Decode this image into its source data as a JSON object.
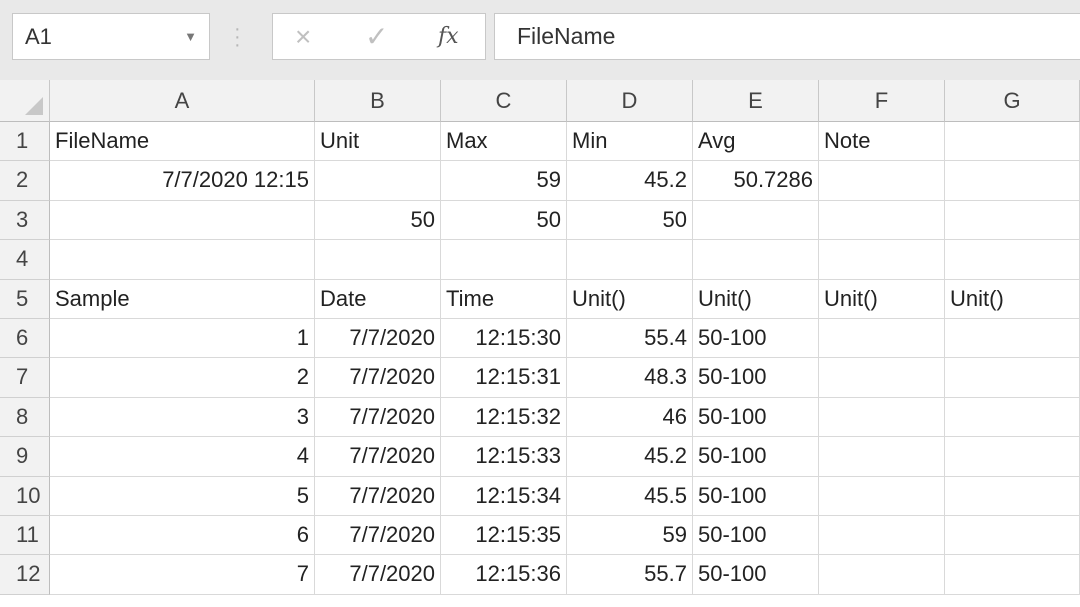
{
  "formula_bar": {
    "name_box": "A1",
    "formula": "FileName",
    "fx_label": "fx",
    "cancel_icon": "×",
    "enter_icon": "✓"
  },
  "columns": [
    "A",
    "B",
    "C",
    "D",
    "E",
    "F",
    "G"
  ],
  "rows": [
    "1",
    "2",
    "3",
    "4",
    "5",
    "6",
    "7",
    "8",
    "9",
    "10",
    "11",
    "12"
  ],
  "cells": {
    "r1": [
      "FileName",
      "Unit",
      "Max",
      "Min",
      "Avg",
      "Note",
      ""
    ],
    "r2": [
      "7/7/2020 12:15",
      "",
      "59",
      "45.2",
      "50.7286",
      "",
      ""
    ],
    "r3": [
      "",
      "50",
      "50",
      "50",
      "",
      "",
      ""
    ],
    "r4": [
      "",
      "",
      "",
      "",
      "",
      "",
      ""
    ],
    "r5": [
      "Sample",
      "Date",
      "Time",
      "Unit()",
      "Unit()",
      "Unit()",
      "Unit()"
    ],
    "r6": [
      "1",
      "7/7/2020",
      "12:15:30",
      "55.4",
      "50-100",
      "",
      ""
    ],
    "r7": [
      "2",
      "7/7/2020",
      "12:15:31",
      "48.3",
      "50-100",
      "",
      ""
    ],
    "r8": [
      "3",
      "7/7/2020",
      "12:15:32",
      "46",
      "50-100",
      "",
      ""
    ],
    "r9": [
      "4",
      "7/7/2020",
      "12:15:33",
      "45.2",
      "50-100",
      "",
      ""
    ],
    "r10": [
      "5",
      "7/7/2020",
      "12:15:34",
      "45.5",
      "50-100",
      "",
      ""
    ],
    "r11": [
      "6",
      "7/7/2020",
      "12:15:35",
      "59",
      "50-100",
      "",
      ""
    ],
    "r12": [
      "7",
      "7/7/2020",
      "12:15:36",
      "55.7",
      "50-100",
      "",
      ""
    ]
  },
  "align": {
    "r2": [
      "right",
      "",
      "right",
      "right",
      "right",
      "",
      ""
    ],
    "r3": [
      "",
      "right",
      "right",
      "right",
      "",
      "",
      ""
    ],
    "r6": [
      "right",
      "right",
      "right",
      "right",
      "",
      "",
      ""
    ],
    "r7": [
      "right",
      "right",
      "right",
      "right",
      "",
      "",
      ""
    ],
    "r8": [
      "right",
      "right",
      "right",
      "right",
      "",
      "",
      ""
    ],
    "r9": [
      "right",
      "right",
      "right",
      "right",
      "",
      "",
      ""
    ],
    "r10": [
      "right",
      "right",
      "right",
      "right",
      "",
      "",
      ""
    ],
    "r11": [
      "right",
      "right",
      "right",
      "right",
      "",
      "",
      ""
    ],
    "r12": [
      "right",
      "right",
      "right",
      "right",
      "",
      "",
      ""
    ]
  }
}
